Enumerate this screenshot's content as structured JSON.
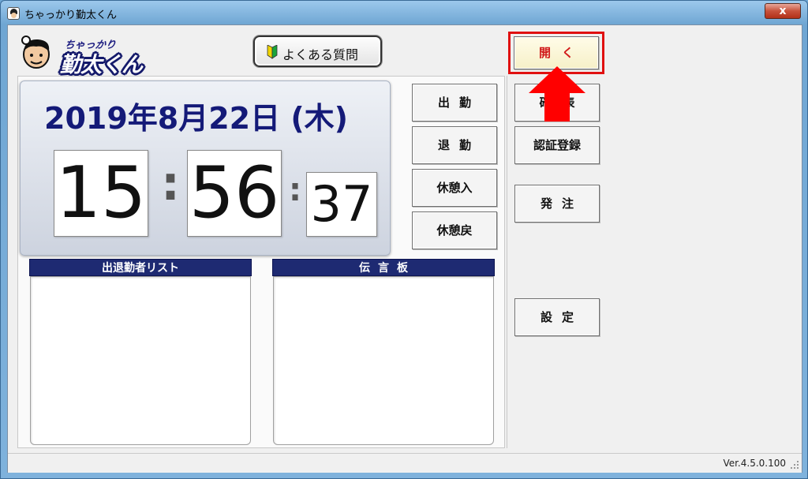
{
  "window": {
    "title": "ちゃっかり勤太くん",
    "close_label": "x"
  },
  "logo": {
    "small_text": "ちゃっかり",
    "main_text": "勤太くん"
  },
  "faq_button": {
    "label": "よくある質問"
  },
  "clock": {
    "date": "2019年8月22日 (木)",
    "hour": "15",
    "minute": "56",
    "second": "37",
    "separator": ":"
  },
  "punch_buttons": {
    "clock_in": "出勤",
    "clock_out": "退勤",
    "break_start": "休憩入",
    "break_end": "休憩戻"
  },
  "lists": {
    "attendance_header": "出退勤者リスト",
    "message_board_header": "伝言板"
  },
  "side_buttons": {
    "open": "開く",
    "confirm": "確認表",
    "auth_register": "認証登録",
    "order": "発注",
    "settings": "設定"
  },
  "status_bar": {
    "version": "Ver.4.5.0.100"
  },
  "colors": {
    "header_navy": "#1e2a72",
    "date_navy": "#141a78",
    "highlight_red": "#e01010",
    "arrow_red": "#ff0000"
  }
}
